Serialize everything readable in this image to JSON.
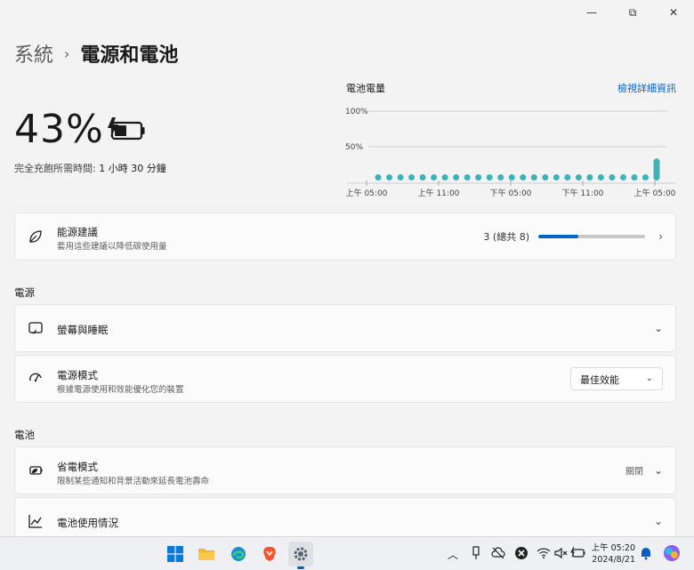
{
  "window": {
    "minimize": "—",
    "maximize": "⧉",
    "close": "✕"
  },
  "breadcrumb": {
    "root": "系統",
    "separator": "›",
    "current": "電源和電池"
  },
  "battery": {
    "percent": "43%",
    "level": 0.43,
    "charge_time_label": "完全充飽所需時間:",
    "charge_time_value": "1 小時 30 分鐘"
  },
  "usage_chart": {
    "title": "電池電量",
    "link": "檢視詳細資訊",
    "chart_data": {
      "type": "bar",
      "title": "電池電量",
      "y_ticks": [
        "100%",
        "50%"
      ],
      "ylim": [
        0,
        100
      ],
      "x_tick_labels": [
        "上午 05:00",
        "上午 11:00",
        "下午 05:00",
        "下午 11:00",
        "上午 05:00"
      ],
      "values": [
        0,
        0,
        0,
        0,
        0,
        0,
        0,
        0,
        0,
        0,
        0,
        0,
        0,
        0,
        0,
        0,
        0,
        0,
        0,
        0,
        0,
        0,
        0,
        0,
        0,
        43
      ],
      "grid": true,
      "accent": "#3fb2b8"
    }
  },
  "energy": {
    "title": "能源建議",
    "subtitle": "套用這些建議以降低碳使用量",
    "count": "3 (總共 8)",
    "progress": 0.375
  },
  "power_section": {
    "heading": "電源",
    "screen_sleep": {
      "title": "螢幕與睡眠"
    },
    "power_mode": {
      "title": "電源模式",
      "subtitle": "根據電源使用和效能優化您的裝置",
      "value": "最佳效能"
    }
  },
  "battery_section": {
    "heading": "電池",
    "saver": {
      "title": "省電模式",
      "subtitle": "限制某些通知和背景活動來延長電池壽命",
      "state": "關閉"
    },
    "usage": {
      "title": "電池使用情況"
    }
  },
  "taskbar": {
    "apps": [
      "windows-start",
      "file-explorer",
      "edge",
      "brave",
      "settings"
    ],
    "tray": {
      "chevron": "︿"
    },
    "clock": {
      "time": "上午 05:20",
      "date": "2024/8/21"
    }
  },
  "colors": {
    "accent": "#0067c0",
    "link": "#0a5cc2",
    "teal": "#3fb2b8"
  }
}
